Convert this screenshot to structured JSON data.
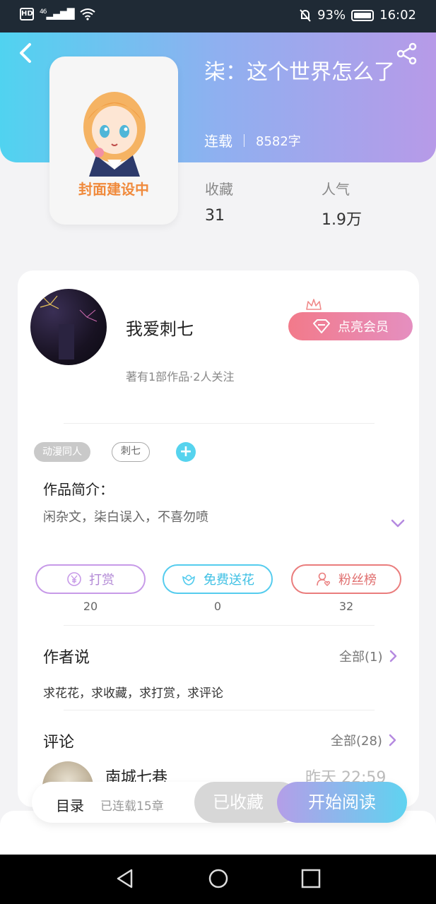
{
  "status_bar": {
    "hd_label": "HD",
    "signal_label": "46",
    "battery_percent": "93%",
    "time": "16:02"
  },
  "book": {
    "title": "柒：这个世界怎么了",
    "status": "连载",
    "word_count": "8582字",
    "cover_caption": "封面建设中",
    "stats": [
      {
        "label": "收藏",
        "value": "31"
      },
      {
        "label": "人气",
        "value": "1.9万"
      }
    ]
  },
  "author": {
    "name": "我爱刺七",
    "info": "著有1部作品·2人关注",
    "vip_button": "点亮会员"
  },
  "tags": [
    "动漫同人",
    "刺七"
  ],
  "intro": {
    "heading": "作品简介：",
    "text": "闲杂文，柒白误入，不喜勿喷"
  },
  "actions": [
    {
      "label": "打赏",
      "count": "20"
    },
    {
      "label": "免费送花",
      "count": "0"
    },
    {
      "label": "粉丝榜",
      "count": "32"
    }
  ],
  "author_says": {
    "heading": "作者说",
    "more": "全部(1)",
    "text": "求花花，求收藏，求打赏，求评论"
  },
  "comments": {
    "heading": "评论",
    "more": "全部(28)",
    "first": {
      "name": "南城七巷",
      "time": "昨天 22:59"
    }
  },
  "bottom_bar": {
    "toc_label": "目录",
    "toc_sub": "已连载15章",
    "fav_label": "已收藏",
    "read_label": "开始阅读"
  },
  "colors": {
    "header_gradient_start": "#50d3f0",
    "header_gradient_end": "#b79ae8",
    "tip": "#c79ae8",
    "flower": "#55ccee",
    "fans": "#ea7d7d",
    "vip": "#f27a8a"
  }
}
